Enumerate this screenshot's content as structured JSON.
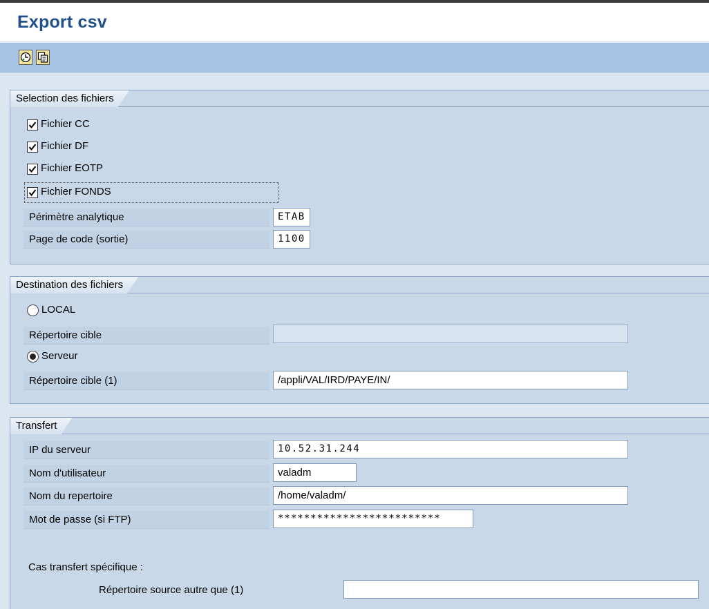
{
  "window": {
    "title": "Export csv"
  },
  "toolbar": {
    "buttons": [
      {
        "icon": "execute-clock-icon"
      },
      {
        "icon": "copy-variant-icon"
      }
    ]
  },
  "selection": {
    "title": "Selection des fichiers",
    "checkboxes": [
      {
        "label": "Fichier CC",
        "checked": true
      },
      {
        "label": "Fichier DF",
        "checked": true
      },
      {
        "label": "Fichier EOTP",
        "checked": true
      },
      {
        "label": "Fichier FONDS",
        "checked": true
      }
    ],
    "perimetre": {
      "label": "Périmètre analytique",
      "value": "ETAB"
    },
    "codepage": {
      "label": "Page de code (sortie)",
      "value": "1100"
    }
  },
  "destination": {
    "title": "Destination des fichiers",
    "local_label": "LOCAL",
    "local_dir_label": "Répertoire cible",
    "local_dir_value": "",
    "server_label": "Serveur",
    "server_dir_label": "Répertoire cible (1)",
    "server_dir_value": "/appli/VAL/IRD/PAYE/IN/",
    "selected": "Serveur"
  },
  "transfert": {
    "title": "Transfert",
    "ip": {
      "label": "IP du serveur",
      "value": "10.52.31.244"
    },
    "user": {
      "label": "Nom d'utilisateur",
      "value": "valadm"
    },
    "dir": {
      "label": "Nom du repertoire",
      "value": "/home/valadm/"
    },
    "password": {
      "label": "Mot de passe (si FTP)",
      "value": "*************************"
    },
    "specific_label": "Cas transfert spécifique :",
    "source_dir_label": "Répertoire source autre que (1)",
    "source_dir_value": ""
  },
  "colors": {
    "title": "#20508a",
    "toolbar": "#a8c4e4",
    "group_bg": "#c9d8e8"
  }
}
